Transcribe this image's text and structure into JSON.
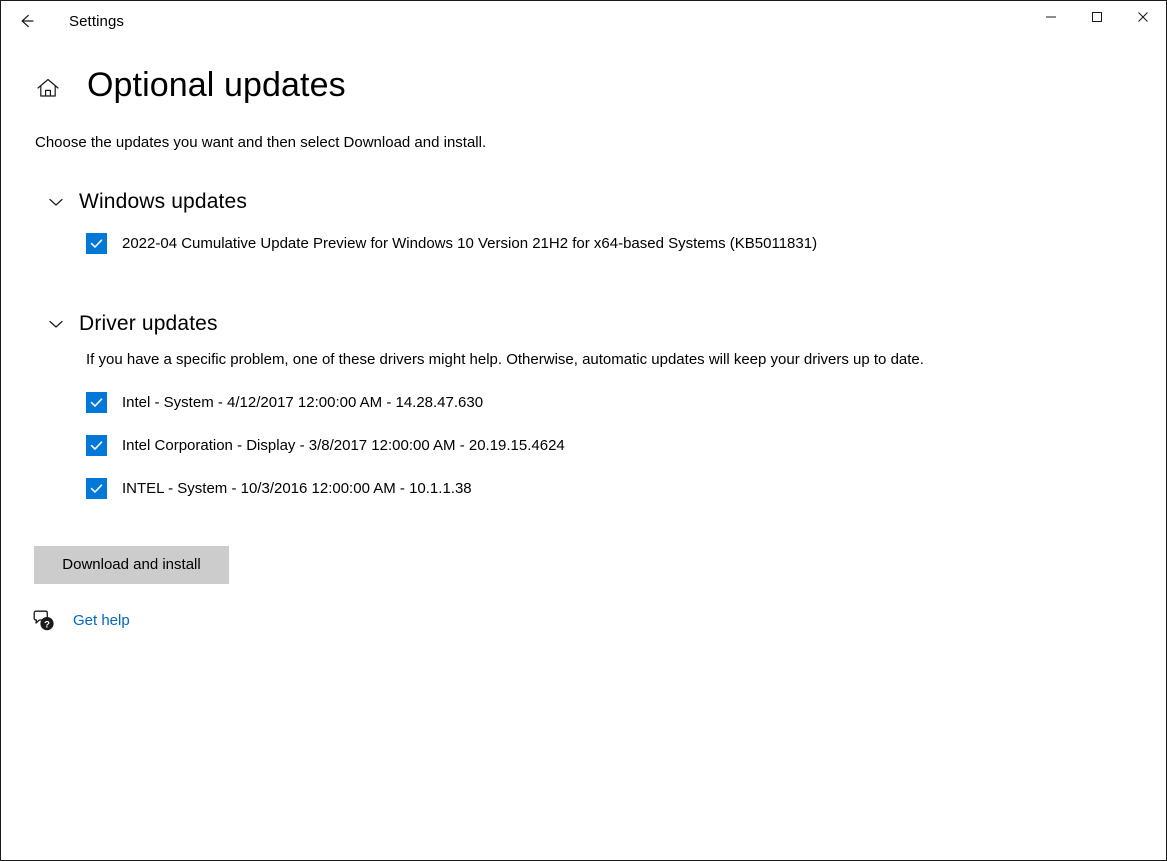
{
  "window": {
    "app_title": "Settings",
    "back_icon": "back-arrow-icon",
    "controls": {
      "minimize": "minimize-icon",
      "maximize": "maximize-icon",
      "close": "close-icon"
    }
  },
  "page": {
    "home_icon": "home-icon",
    "title": "Optional updates",
    "subtitle": "Choose the updates you want and then select Download and install."
  },
  "sections": [
    {
      "id": "windows-updates",
      "title": "Windows updates",
      "chevron_icon": "chevron-down-icon",
      "expanded": true,
      "note": "",
      "items": [
        {
          "label": "2022-04 Cumulative Update Preview for Windows 10 Version 21H2 for x64-based Systems (KB5011831)",
          "checked": true
        }
      ]
    },
    {
      "id": "driver-updates",
      "title": "Driver updates",
      "chevron_icon": "chevron-down-icon",
      "expanded": true,
      "note": "If you have a specific problem, one of these drivers might help. Otherwise, automatic updates will keep your drivers up to date.",
      "items": [
        {
          "label": "Intel - System - 4/12/2017 12:00:00 AM - 14.28.47.630",
          "checked": true
        },
        {
          "label": "Intel Corporation - Display - 3/8/2017 12:00:00 AM - 20.19.15.4624",
          "checked": true
        },
        {
          "label": "INTEL - System - 10/3/2016 12:00:00 AM - 10.1.1.38",
          "checked": true
        }
      ]
    }
  ],
  "actions": {
    "download_label": "Download and install"
  },
  "help": {
    "icon": "help-chat-icon",
    "label": "Get help"
  },
  "colors": {
    "accent": "#0078d7",
    "link": "#0067c0",
    "button_bg": "#cccccc",
    "text": "#000000",
    "window_bg": "#ffffff"
  }
}
